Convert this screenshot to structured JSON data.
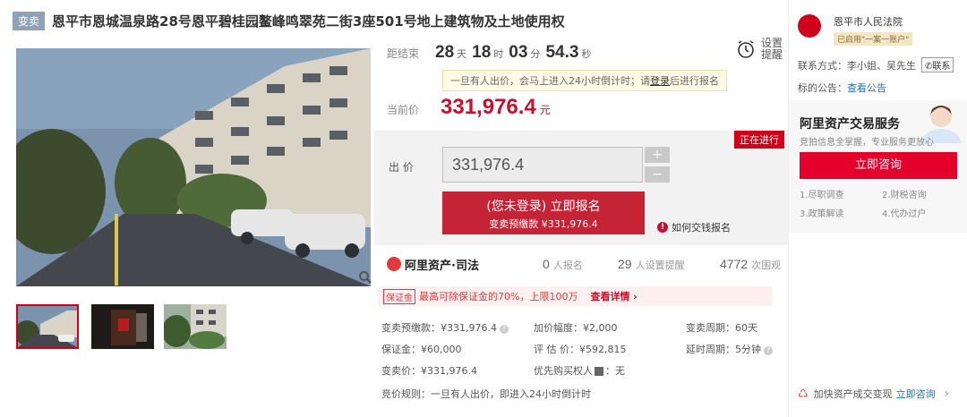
{
  "header": {
    "tag": "变卖",
    "title": "恩平市恩城温泉路28号恩平碧桂园鳌峰鸣翠苑二街3座501号地上建筑物及土地使用权"
  },
  "countdown": {
    "label": "距结束",
    "days": "28",
    "days_unit": "天",
    "hours": "18",
    "hours_unit": "时",
    "minutes": "03",
    "minutes_unit": "分",
    "seconds": "54.3",
    "seconds_unit": "秒"
  },
  "remind": {
    "label": "设置提醒",
    "icon": "alarm-clock-icon"
  },
  "notice": {
    "text_before": "一旦有人出价，会马上进入24小时倒计时；请",
    "login": "登录",
    "text_after": "后进行报名"
  },
  "price": {
    "label": "当前价",
    "value": "331,976.4",
    "unit": "元"
  },
  "bid": {
    "status": "正在进行",
    "label": "出 价",
    "input_value": "331,976.4",
    "plus": "+",
    "minus": "−",
    "signup_main": "(您未登录) 立即报名",
    "signup_sub": "变卖预缴款 ¥331,976.4",
    "howto": "如何交钱报名"
  },
  "stats": {
    "brand": "阿里资产·司法",
    "signups": "0",
    "signups_label": "人报名",
    "reminders": "29",
    "reminders_label": "人设置提醒",
    "views": "4772",
    "views_label": "次围观"
  },
  "promo": {
    "tag": "保证金",
    "text": "最高可除保证金的70%，上限100万",
    "link": "查看详情 ›"
  },
  "details": {
    "prepay": "变卖预缴款：¥331,976.4",
    "increment": "加价幅度：¥2,000",
    "period": "变卖周期：60天",
    "deposit": "保证金：¥60,000",
    "appraisal": "评 估 价：¥592,815",
    "delay": "延时周期：5分钟",
    "sale_price": "变卖价：¥331,976.4",
    "priority": "优先购买权人",
    "priority_value": "：无",
    "rule": "竞价规则：一旦有人出价，即进入24小时倒计时"
  },
  "court": {
    "name": "恩平市人民法院",
    "badge": "已启用\"一案一账户\"",
    "contact": "联系方式：李小姐、吴先生",
    "contact_btn": "联系",
    "notice_label": "标的公告：",
    "notice_link": "查看公告"
  },
  "service": {
    "title": "阿里资产交易服务",
    "subtitle": "竞拍信息全掌握，专业服务更放心",
    "button": "立即咨询",
    "items": [
      "1.尽职调查",
      "2.财税咨询",
      "3.政策解读",
      "4.代办过户"
    ]
  },
  "bottom": {
    "text": "加快资产成交变现",
    "link": "立即咨询",
    "arrow": "›"
  },
  "colors": {
    "accent": "#c8102e",
    "button": "#c42436",
    "consult": "#e4002b"
  }
}
